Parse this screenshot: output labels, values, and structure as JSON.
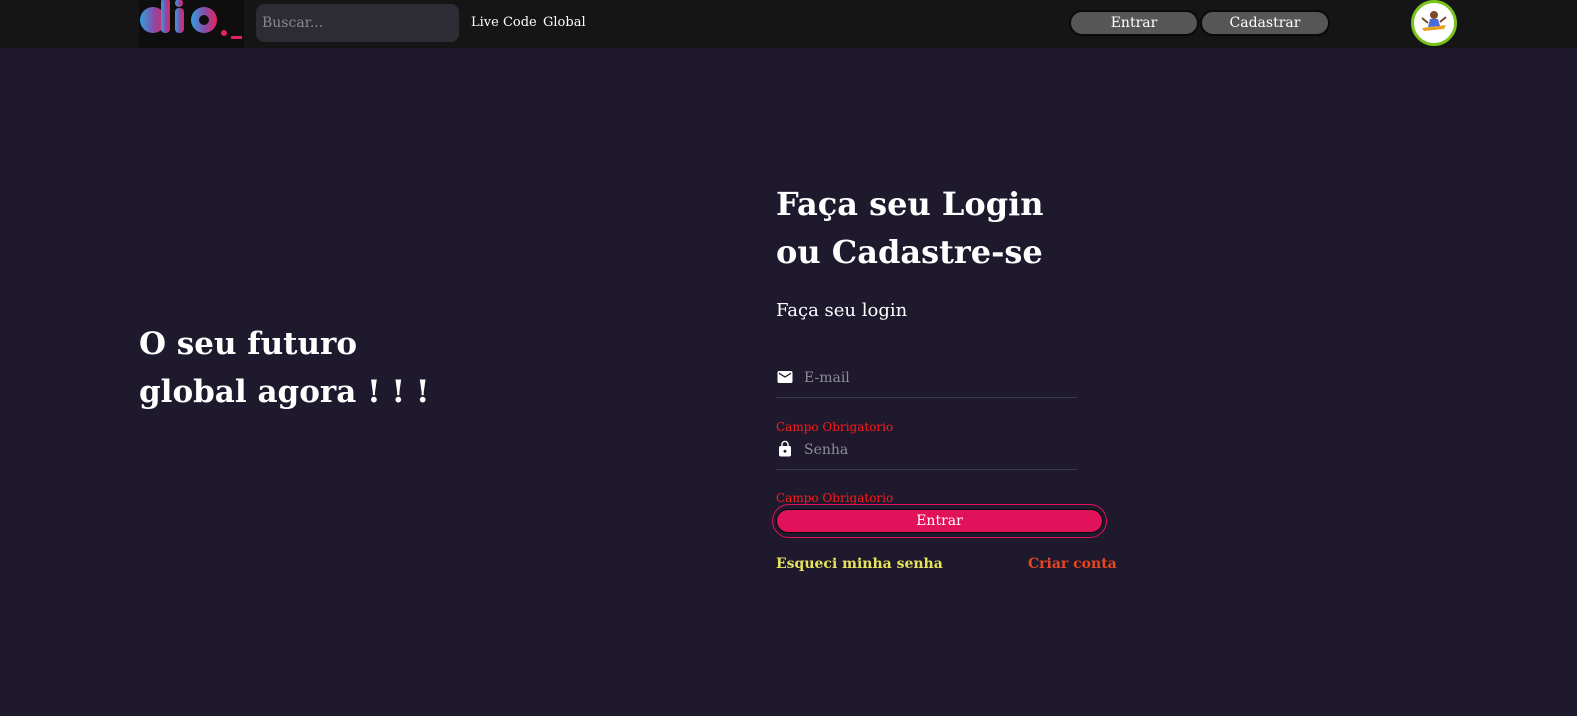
{
  "header": {
    "search_placeholder": "Buscar...",
    "nav": [
      "Live Code",
      "Global"
    ],
    "login_button": "Entrar",
    "register_button": "Cadastrar"
  },
  "hero": {
    "title": "O seu futuro global agora ! ! !"
  },
  "form": {
    "title": "Faça seu Login ou Cadastre-se",
    "subtitle": "Faça seu login",
    "email_placeholder": "E-mail",
    "password_placeholder": "Senha",
    "email_error": "Campo Obrigatorio",
    "password_error": "Campo Obrigatorio",
    "submit_label": "Entrar",
    "forgot_password": "Esqueci minha senha",
    "create_account": "Criar conta"
  },
  "colors": {
    "background": "#1e192c",
    "header": "#151515",
    "primary": "#e2125a",
    "error": "#ff1a1a",
    "forgot_link": "#e6e35a",
    "create_link": "#e8461f",
    "avatar_ring": "#7cc21f"
  },
  "icons": {
    "logo": "dio-logo",
    "email": "mail-icon",
    "password": "lock-icon",
    "avatar": "avatar-image"
  }
}
